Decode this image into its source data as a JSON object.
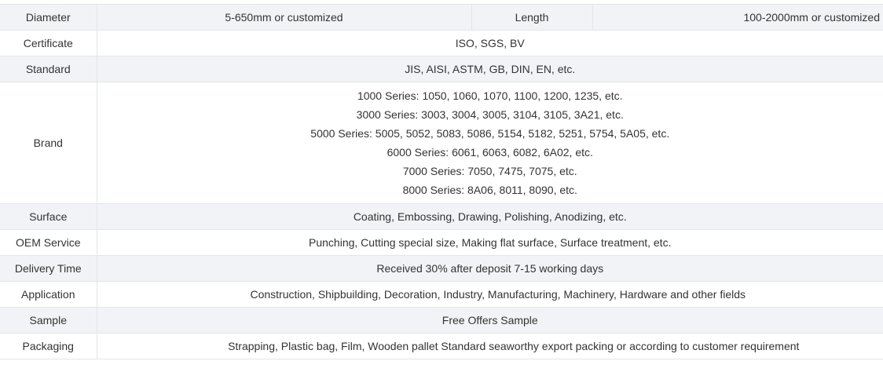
{
  "rows": [
    {
      "label": "Diameter",
      "value": "5-650mm or customized",
      "extra_label": "Length",
      "extra_value": "100-2000mm or customized",
      "shaded": true
    },
    {
      "label": "Certificate",
      "value": "ISO, SGS, BV",
      "shaded": false
    },
    {
      "label": "Standard",
      "value": "JIS, AISI, ASTM, GB, DIN, EN, etc.",
      "shaded": true
    },
    {
      "label": "Brand",
      "lines": [
        "1000 Series: 1050, 1060, 1070, 1100, 1200, 1235, etc.",
        "3000 Series: 3003, 3004, 3005, 3104, 3105, 3A21, etc.",
        "5000 Series: 5005, 5052, 5083, 5086, 5154, 5182, 5251, 5754, 5A05, etc.",
        "6000 Series: 6061, 6063, 6082, 6A02, etc.",
        "7000 Series: 7050, 7475, 7075, etc.",
        "8000 Series: 8A06, 8011, 8090, etc."
      ],
      "shaded": false
    },
    {
      "label": "Surface",
      "value": "Coating, Embossing, Drawing, Polishing, Anodizing, etc.",
      "shaded": true
    },
    {
      "label": "OEM Service",
      "value": "Punching, Cutting special size, Making flat surface, Surface treatment, etc.",
      "shaded": false
    },
    {
      "label": "Delivery Time",
      "value": "Received 30% after deposit 7-15 working days",
      "shaded": true
    },
    {
      "label": "Application",
      "value": "Construction, Shipbuilding, Decoration, Industry, Manufacturing, Machinery, Hardware and other fields",
      "shaded": false
    },
    {
      "label": "Sample",
      "value": "Free Offers Sample",
      "shaded": true
    },
    {
      "label": "Packaging",
      "value": "Strapping, Plastic bag, Film, Wooden pallet Standard seaworthy export packing or according to customer requirement",
      "shaded": false
    }
  ],
  "colors": {
    "shaded_row": "#f1f3f6",
    "border": "#e3e5e8",
    "text": "#333333"
  }
}
